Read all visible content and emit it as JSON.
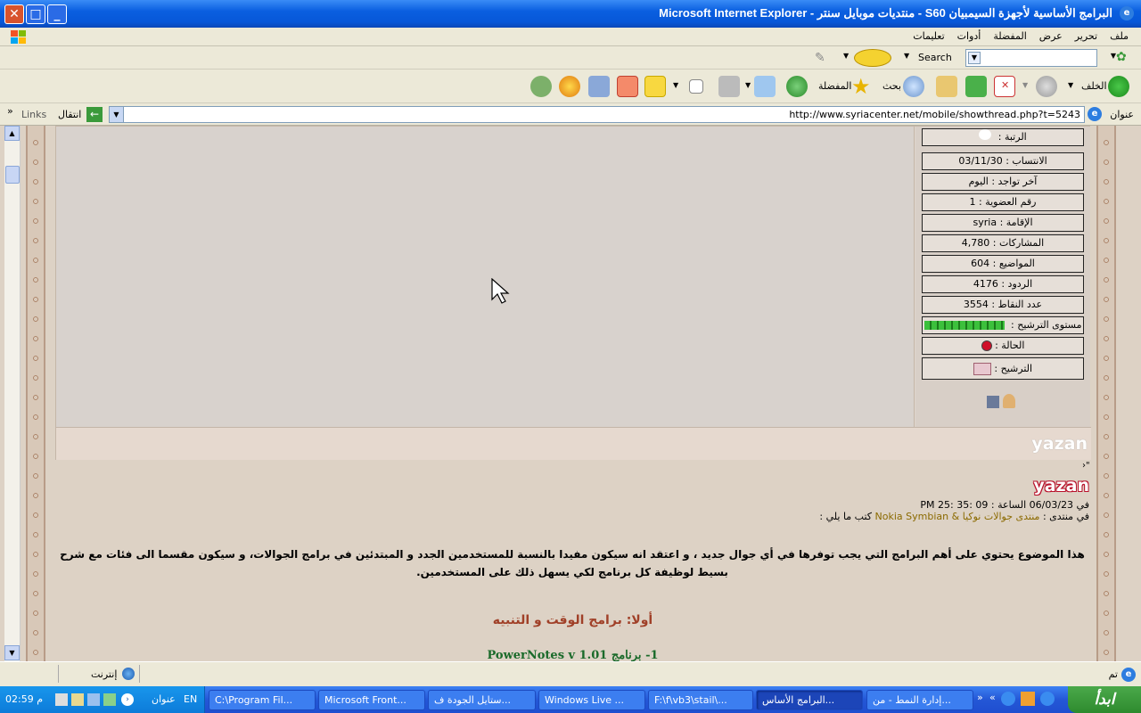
{
  "window": {
    "title": "البرامج الأساسية لأجهزة السيمبيان S60 - منتديات موبايل سنتر - Microsoft Internet Explorer"
  },
  "menu": {
    "items": [
      "ملف",
      "تحرير",
      "عرض",
      "المفضلة",
      "أدوات",
      "تعليمات"
    ]
  },
  "search": {
    "label": "Search"
  },
  "toolbar": {
    "back_label": "الخلف",
    "search_label": "بحث",
    "favorites_label": "المفضلة"
  },
  "address": {
    "label": "عنوان",
    "url": "http://www.syriacenter.net/mobile/showthread.php?t=5243",
    "go_label": "انتقال",
    "links_label": "Links"
  },
  "profile": {
    "rows": [
      {
        "label": "الرتبة :",
        "value": ""
      },
      {
        "label": "الانتساب :",
        "value": "03/11/30"
      },
      {
        "label": "آخر تواجد :",
        "value": "اليوم"
      },
      {
        "label": "رقم العضوية :",
        "value": "1"
      },
      {
        "label": "الإقامة :",
        "value": "syria"
      },
      {
        "label": "المشاركات :",
        "value": "4,780"
      },
      {
        "label": "المواضيع :",
        "value": "604"
      },
      {
        "label": "الردود :",
        "value": "4176"
      },
      {
        "label": "عدد النقاط :",
        "value": "3554"
      },
      {
        "label": "مستوى الترشيح :",
        "value": ""
      },
      {
        "label": "الحالة :",
        "value": ""
      },
      {
        "label": "الترشيح :",
        "value": ""
      }
    ],
    "level_fraction": 1.0
  },
  "post": {
    "author": "yazan",
    "author_again": "yazan",
    "date_line": "في 06/03/23 الساعة : 09 :35 :25 PM",
    "forum_prefix": "في منتدى :",
    "forum_name": "منتدى جوالات نوكيا & Nokia Symbian",
    "forum_suffix": "كتب ما يلي :",
    "body": "هذا الموضوع يحتوي على أهم البرامج التي يجب توفرها في أي جوال جديد ، و اعتقد انه سيكون مفيدا بالنسبة للمستخدمين الجدد و المبتدئين في برامج الجوالات، و سيكون مقسما الى فئات مع شرح بسيط لوظيفة كل برنامج لكي يسهل ذلك على المستخدمين.",
    "heading": "أولا: برامج الوقت و التنبيه",
    "item1": "1- برنامج PowerNotes v 1.01"
  },
  "status": {
    "left": "تم",
    "zone": "إنترنت"
  },
  "taskbar": {
    "start": "ابدأ",
    "tasks": [
      "إدارة النمط - من...",
      "البرامج الأساس...",
      "F:\\f\\vb3\\stail\\...",
      "Windows Live ...",
      "ستايل الجودة ف...",
      "Microsoft Front...",
      "C:\\Program Fil..."
    ],
    "address_label": "عنوان",
    "lang": "EN",
    "clock": "02:59 م"
  },
  "colors": {
    "accent": "#0757d8",
    "forum_link": "#8b6a00",
    "heading": "#a04028",
    "item": "#1a6a2a"
  }
}
